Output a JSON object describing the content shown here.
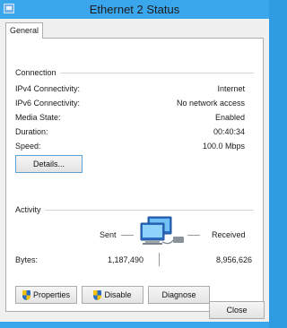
{
  "window": {
    "title": "Ethernet 2 Status"
  },
  "tabs": [
    {
      "label": "General"
    }
  ],
  "connection": {
    "heading": "Connection",
    "rows": [
      {
        "label": "IPv4 Connectivity:",
        "value": "Internet"
      },
      {
        "label": "IPv6 Connectivity:",
        "value": "No network access"
      },
      {
        "label": "Media State:",
        "value": "Enabled"
      },
      {
        "label": "Duration:",
        "value": "00:40:34"
      },
      {
        "label": "Speed:",
        "value": "100.0 Mbps"
      }
    ],
    "details_button": "Details..."
  },
  "activity": {
    "heading": "Activity",
    "sent_label": "Sent",
    "received_label": "Received",
    "bytes_label": "Bytes:",
    "bytes_sent": "1,187,490",
    "bytes_received": "8,956,626",
    "icon": "network-computers-icon"
  },
  "buttons": {
    "properties": "Properties",
    "disable": "Disable",
    "diagnose": "Diagnose",
    "close": "Close"
  },
  "colors": {
    "title_bar": "#3aa6ec",
    "focus_border": "#5aa1d8"
  }
}
